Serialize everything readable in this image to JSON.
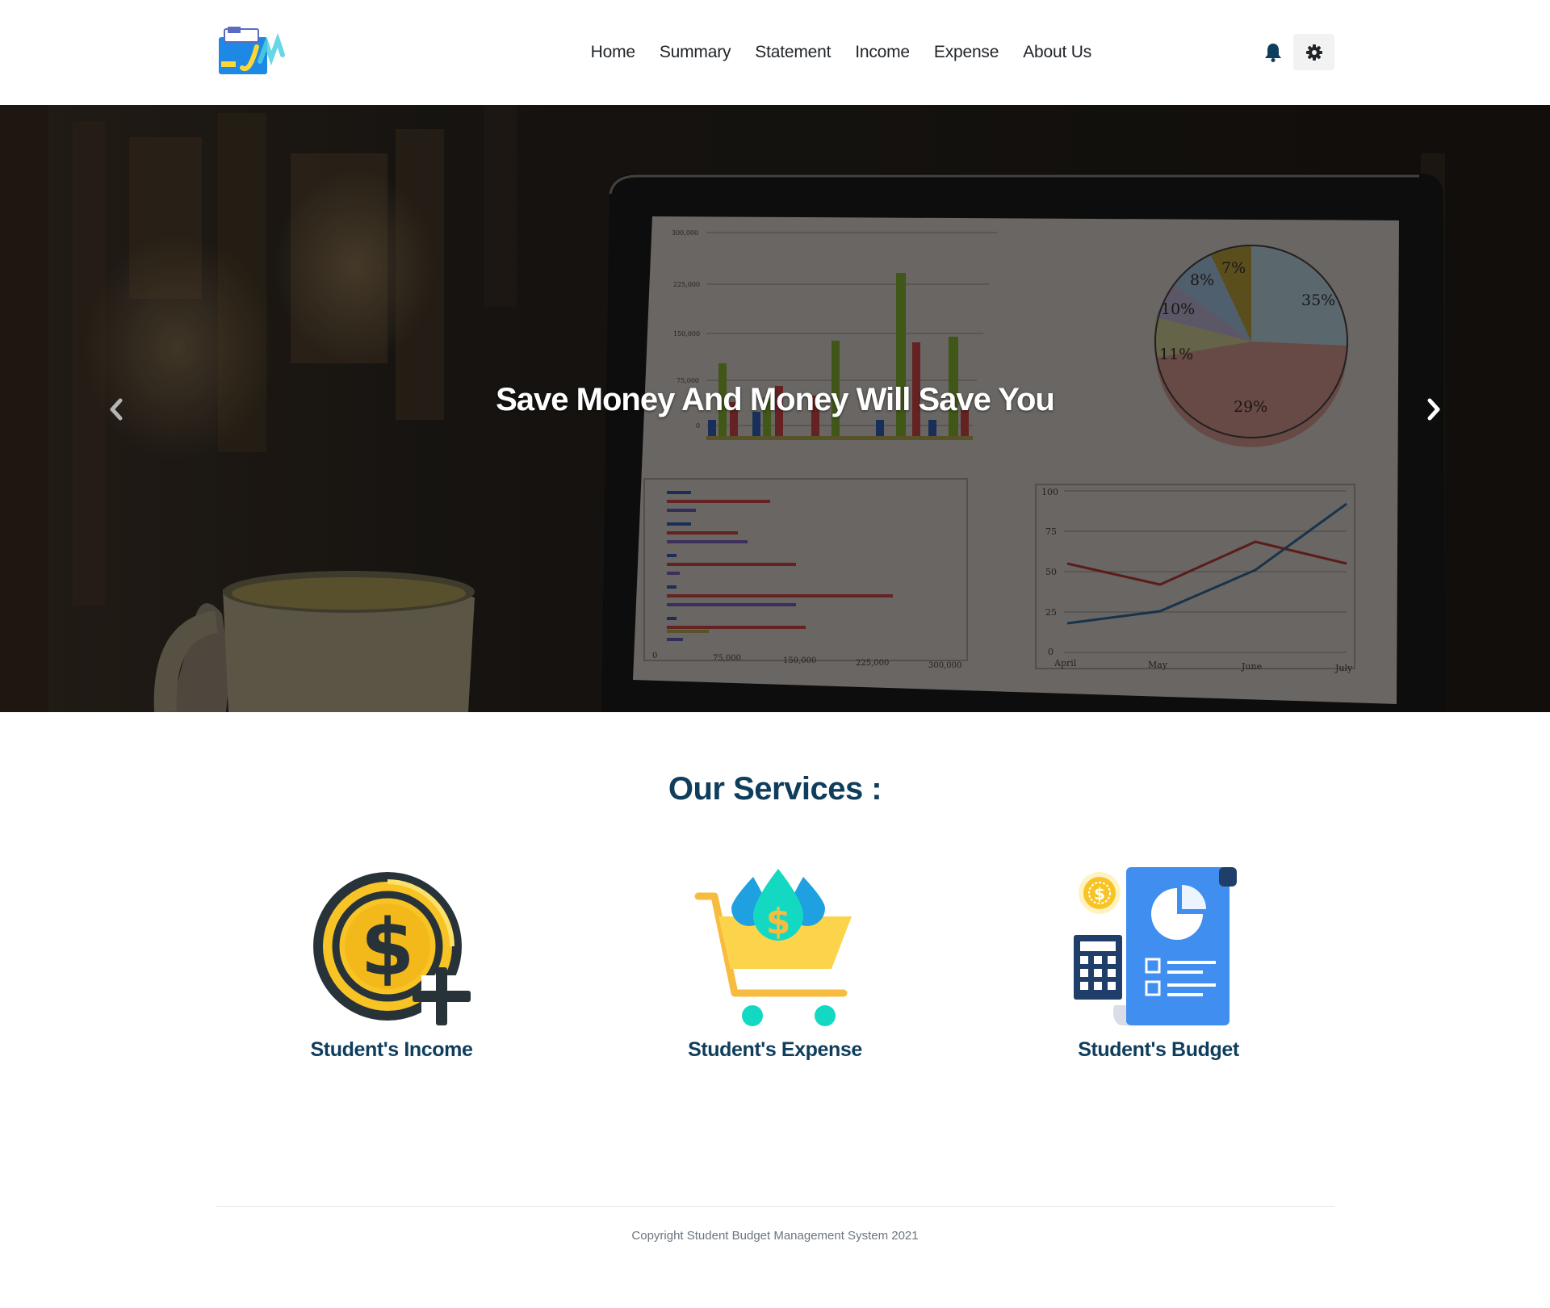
{
  "nav": {
    "logo_alt": "Student Budget logo",
    "links": [
      "Home",
      "Summary",
      "Statement",
      "Income",
      "Expense",
      "About Us"
    ],
    "notification_icon": "bell-icon",
    "settings_icon": "gear-icon"
  },
  "hero": {
    "caption": "Save Money And Money Will Save You",
    "prev_icon": "chevron-left-icon",
    "next_icon": "chevron-right-icon",
    "screen_bar_ticks": [
      "300,000",
      "225,000",
      "150,000",
      "75,000",
      "0"
    ],
    "screen_pie_labels": [
      "35%",
      "29%",
      "11%",
      "10%",
      "8%",
      "7%"
    ],
    "screen_hbar_ticks": [
      "0",
      "75,000",
      "150,000",
      "225,000",
      "300,000"
    ],
    "screen_line_yticks": [
      "100",
      "75",
      "50",
      "25",
      "0"
    ],
    "screen_line_xticks": [
      "April",
      "May",
      "June",
      "July"
    ]
  },
  "services": {
    "title": "Our Services :",
    "items": [
      {
        "label": "Student's Income",
        "icon": "dollar-coin-plus-icon"
      },
      {
        "label": "Student's Expense",
        "icon": "shopping-cart-dollar-icon"
      },
      {
        "label": "Student's Budget",
        "icon": "budget-report-calculator-icon"
      }
    ]
  },
  "footer": {
    "copyright": "Copyright Student Budget Management System 2021"
  },
  "colors": {
    "heading": "#0f3d5c",
    "nav_text": "#212529",
    "footer_text": "#6c757d",
    "coin_yellow": "#f7c325",
    "budget_blue": "#4a90f0"
  }
}
